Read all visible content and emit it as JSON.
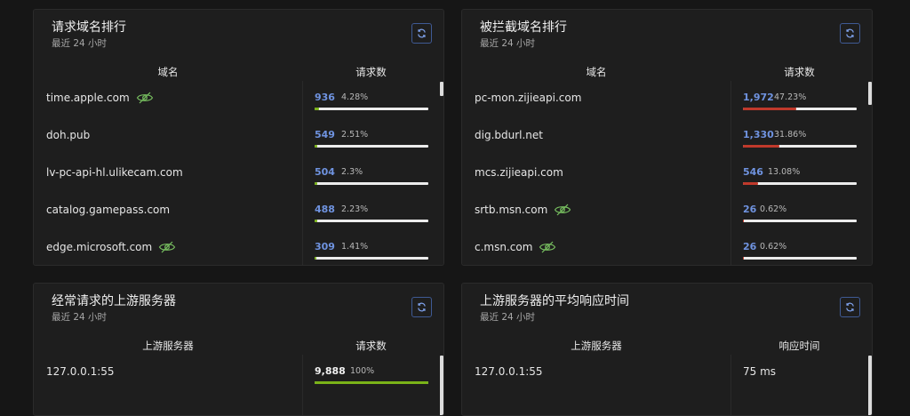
{
  "colors": {
    "green": "#7ab318",
    "red": "#c0392b",
    "accent": "#6f93e0",
    "eye": "#78c060"
  },
  "top_queried": {
    "title": "请求域名排行",
    "subtitle": "最近 24 小时",
    "col_domain": "域名",
    "col_count": "请求数",
    "rows": [
      {
        "domain": "time.apple.com",
        "count": "936",
        "pct": "4.28%",
        "fraction": 0.0428,
        "hidden": true
      },
      {
        "domain": "doh.pub",
        "count": "549",
        "pct": "2.51%",
        "fraction": 0.0251,
        "hidden": false
      },
      {
        "domain": "lv-pc-api-hl.ulikecam.com",
        "count": "504",
        "pct": "2.3%",
        "fraction": 0.023,
        "hidden": false
      },
      {
        "domain": "catalog.gamepass.com",
        "count": "488",
        "pct": "2.23%",
        "fraction": 0.0223,
        "hidden": false
      },
      {
        "domain": "edge.microsoft.com",
        "count": "309",
        "pct": "1.41%",
        "fraction": 0.0141,
        "hidden": true
      }
    ]
  },
  "top_blocked": {
    "title": "被拦截域名排行",
    "subtitle": "最近 24 小时",
    "col_domain": "域名",
    "col_count": "请求数",
    "rows": [
      {
        "domain": "pc-mon.zijieapi.com",
        "count": "1,972",
        "pct": "47.23%",
        "fraction": 0.4723,
        "hidden": false
      },
      {
        "domain": "dig.bdurl.net",
        "count": "1,330",
        "pct": "31.86%",
        "fraction": 0.3186,
        "hidden": false
      },
      {
        "domain": "mcs.zijieapi.com",
        "count": "546",
        "pct": "13.08%",
        "fraction": 0.1308,
        "hidden": false
      },
      {
        "domain": "srtb.msn.com",
        "count": "26",
        "pct": "0.62%",
        "fraction": 0.0062,
        "hidden": true
      },
      {
        "domain": "c.msn.com",
        "count": "26",
        "pct": "0.62%",
        "fraction": 0.0062,
        "hidden": true
      }
    ]
  },
  "top_upstreams": {
    "title": "经常请求的上游服务器",
    "subtitle": "最近 24 小时",
    "col_server": "上游服务器",
    "col_count": "请求数",
    "rows": [
      {
        "server": "127.0.0.1:55",
        "count": "9,888",
        "pct": "100%",
        "fraction": 1.0
      }
    ]
  },
  "avg_response": {
    "title": "上游服务器的平均响应时间",
    "subtitle": "最近 24 小时",
    "col_server": "上游服务器",
    "col_time": "响应时间",
    "rows": [
      {
        "server": "127.0.0.1:55",
        "time": "75 ms"
      }
    ]
  }
}
